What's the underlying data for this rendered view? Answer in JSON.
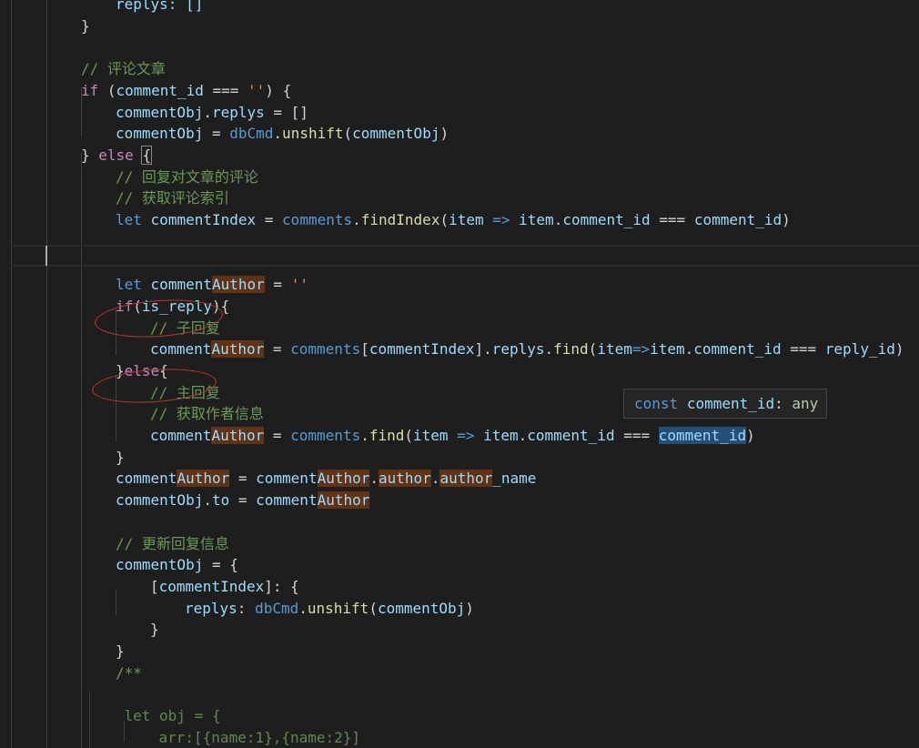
{
  "lines": [
    {
      "indent": 2,
      "tokens": [
        {
          "t": "replys: []",
          "c": "v"
        }
      ]
    },
    {
      "indent": 1,
      "tokens": [
        {
          "t": "}",
          "c": "d"
        }
      ]
    },
    {
      "indent": 0,
      "tokens": []
    },
    {
      "indent": 1,
      "tokens": [
        {
          "t": "// 评论文章",
          "c": "m"
        }
      ]
    },
    {
      "indent": 1,
      "tokens": [
        {
          "t": "if",
          "c": "c"
        },
        {
          "t": " (",
          "c": "d"
        },
        {
          "t": "comment_id",
          "c": "v"
        },
        {
          "t": " === ",
          "c": "o"
        },
        {
          "t": "''",
          "c": "s"
        },
        {
          "t": ") {",
          "c": "d"
        }
      ]
    },
    {
      "indent": 2,
      "tokens": [
        {
          "t": "commentObj",
          "c": "v"
        },
        {
          "t": ".",
          "c": "d"
        },
        {
          "t": "replys",
          "c": "v"
        },
        {
          "t": " = []",
          "c": "d"
        }
      ]
    },
    {
      "indent": 2,
      "tokens": [
        {
          "t": "commentObj",
          "c": "v"
        },
        {
          "t": " = ",
          "c": "d"
        },
        {
          "t": "dbCmd",
          "c": "k"
        },
        {
          "t": ".",
          "c": "d"
        },
        {
          "t": "unshift",
          "c": "f"
        },
        {
          "t": "(",
          "c": "d"
        },
        {
          "t": "commentObj",
          "c": "v"
        },
        {
          "t": ")",
          "c": "d"
        }
      ]
    },
    {
      "indent": 1,
      "tokens": [
        {
          "t": "} ",
          "c": "d"
        },
        {
          "t": "else",
          "c": "c"
        },
        {
          "t": " ",
          "c": "d"
        },
        {
          "t": "{",
          "c": "d",
          "bracket": true
        }
      ]
    },
    {
      "indent": 2,
      "tokens": [
        {
          "t": "// 回复对文章的评论",
          "c": "m"
        }
      ]
    },
    {
      "indent": 2,
      "tokens": [
        {
          "t": "// 获取评论索引",
          "c": "m"
        }
      ]
    },
    {
      "indent": 2,
      "tokens": [
        {
          "t": "let",
          "c": "k"
        },
        {
          "t": " ",
          "c": "d"
        },
        {
          "t": "commentIndex",
          "c": "v"
        },
        {
          "t": " = ",
          "c": "d"
        },
        {
          "t": "comments",
          "c": "k"
        },
        {
          "t": ".",
          "c": "d"
        },
        {
          "t": "findIndex",
          "c": "f"
        },
        {
          "t": "(",
          "c": "d"
        },
        {
          "t": "item",
          "c": "v"
        },
        {
          "t": " => ",
          "c": "k"
        },
        {
          "t": "item",
          "c": "v"
        },
        {
          "t": ".",
          "c": "d"
        },
        {
          "t": "comment_id",
          "c": "v"
        },
        {
          "t": " === ",
          "c": "o"
        },
        {
          "t": "comment_id",
          "c": "v"
        },
        {
          "t": ")",
          "c": "d"
        }
      ]
    },
    {
      "indent": 0,
      "tokens": []
    },
    {
      "indent": 0,
      "tokens": []
    },
    {
      "indent": 2,
      "tokens": [
        {
          "t": "let",
          "c": "k"
        },
        {
          "t": " ",
          "c": "d"
        },
        {
          "t": "comment",
          "c": "v"
        },
        {
          "t": "Author",
          "c": "v",
          "hl": true
        },
        {
          "t": " = ",
          "c": "d"
        },
        {
          "t": "''",
          "c": "s"
        }
      ]
    },
    {
      "indent": 2,
      "tokens": [
        {
          "t": "if",
          "c": "c"
        },
        {
          "t": "(",
          "c": "d"
        },
        {
          "t": "is_reply",
          "c": "v"
        },
        {
          "t": "){",
          "c": "d"
        }
      ]
    },
    {
      "indent": 3,
      "tokens": [
        {
          "t": "// 子回复",
          "c": "m"
        }
      ]
    },
    {
      "indent": 3,
      "tokens": [
        {
          "t": "comment",
          "c": "v"
        },
        {
          "t": "Author",
          "c": "v",
          "hl": true
        },
        {
          "t": " = ",
          "c": "d"
        },
        {
          "t": "comments",
          "c": "k"
        },
        {
          "t": "[",
          "c": "d"
        },
        {
          "t": "commentIndex",
          "c": "v"
        },
        {
          "t": "].",
          "c": "d"
        },
        {
          "t": "replys",
          "c": "v"
        },
        {
          "t": ".",
          "c": "d"
        },
        {
          "t": "find",
          "c": "f"
        },
        {
          "t": "(",
          "c": "d"
        },
        {
          "t": "item",
          "c": "v"
        },
        {
          "t": "=>",
          "c": "k"
        },
        {
          "t": "item",
          "c": "v"
        },
        {
          "t": ".",
          "c": "d"
        },
        {
          "t": "comment_id",
          "c": "v"
        },
        {
          "t": " === ",
          "c": "o"
        },
        {
          "t": "reply_id",
          "c": "v"
        },
        {
          "t": ")",
          "c": "d"
        }
      ]
    },
    {
      "indent": 2,
      "tokens": [
        {
          "t": "}",
          "c": "d"
        },
        {
          "t": "else",
          "c": "c"
        },
        {
          "t": "{",
          "c": "d"
        }
      ]
    },
    {
      "indent": 3,
      "tokens": [
        {
          "t": "// 主回复",
          "c": "m"
        }
      ]
    },
    {
      "indent": 3,
      "tokens": [
        {
          "t": "// 获取作者信息",
          "c": "m"
        }
      ]
    },
    {
      "indent": 3,
      "tokens": [
        {
          "t": "comment",
          "c": "v"
        },
        {
          "t": "Author",
          "c": "v",
          "hl": true
        },
        {
          "t": " = ",
          "c": "d"
        },
        {
          "t": "comments",
          "c": "k"
        },
        {
          "t": ".",
          "c": "d"
        },
        {
          "t": "find",
          "c": "f"
        },
        {
          "t": "(",
          "c": "d"
        },
        {
          "t": "item",
          "c": "v"
        },
        {
          "t": " => ",
          "c": "k"
        },
        {
          "t": "item",
          "c": "v"
        },
        {
          "t": ".",
          "c": "d"
        },
        {
          "t": "comment_id",
          "c": "v"
        },
        {
          "t": " === ",
          "c": "o"
        },
        {
          "t": "comment_id",
          "c": "v",
          "hlb": true
        },
        {
          "t": ")",
          "c": "d"
        }
      ]
    },
    {
      "indent": 2,
      "tokens": [
        {
          "t": "}",
          "c": "d"
        }
      ]
    },
    {
      "indent": 2,
      "tokens": [
        {
          "t": "comment",
          "c": "v"
        },
        {
          "t": "Author",
          "c": "v",
          "hl": true
        },
        {
          "t": " = ",
          "c": "d"
        },
        {
          "t": "comment",
          "c": "v"
        },
        {
          "t": "Author",
          "c": "v",
          "hl": true
        },
        {
          "t": ".",
          "c": "d"
        },
        {
          "t": "author",
          "c": "v",
          "hl": true
        },
        {
          "t": ".",
          "c": "d"
        },
        {
          "t": "author",
          "c": "v",
          "hl": true
        },
        {
          "t": "_name",
          "c": "v"
        }
      ]
    },
    {
      "indent": 2,
      "tokens": [
        {
          "t": "commentObj",
          "c": "v"
        },
        {
          "t": ".",
          "c": "d"
        },
        {
          "t": "to",
          "c": "v"
        },
        {
          "t": " = ",
          "c": "d"
        },
        {
          "t": "comment",
          "c": "v"
        },
        {
          "t": "Author",
          "c": "v",
          "hl": true
        }
      ]
    },
    {
      "indent": 0,
      "tokens": []
    },
    {
      "indent": 2,
      "tokens": [
        {
          "t": "// 更新回复信息",
          "c": "m"
        }
      ]
    },
    {
      "indent": 2,
      "tokens": [
        {
          "t": "commentObj",
          "c": "v"
        },
        {
          "t": " = {",
          "c": "d"
        }
      ]
    },
    {
      "indent": 3,
      "tokens": [
        {
          "t": "[",
          "c": "d"
        },
        {
          "t": "commentIndex",
          "c": "v"
        },
        {
          "t": "]: {",
          "c": "d"
        }
      ]
    },
    {
      "indent": 4,
      "tokens": [
        {
          "t": "replys",
          "c": "v"
        },
        {
          "t": ": ",
          "c": "d"
        },
        {
          "t": "dbCmd",
          "c": "k"
        },
        {
          "t": ".",
          "c": "d"
        },
        {
          "t": "unshift",
          "c": "f"
        },
        {
          "t": "(",
          "c": "d"
        },
        {
          "t": "commentObj",
          "c": "v"
        },
        {
          "t": ")",
          "c": "d"
        }
      ]
    },
    {
      "indent": 3,
      "tokens": [
        {
          "t": "}",
          "c": "d"
        }
      ]
    },
    {
      "indent": 2,
      "tokens": [
        {
          "t": "}",
          "c": "d"
        }
      ]
    },
    {
      "indent": 2,
      "tokens": [
        {
          "t": "/**",
          "c": "m"
        }
      ]
    },
    {
      "indent": 0,
      "tokens": []
    },
    {
      "indent": 2.25,
      "tokens": [
        {
          "t": "let obj = {",
          "c": "dm"
        }
      ]
    },
    {
      "indent": 3.25,
      "tokens": [
        {
          "t": "arr:[{name:1},{name:2}]",
          "c": "dm"
        }
      ]
    },
    {
      "indent": 2.25,
      "tokens": [
        {
          "t": "}",
          "c": "dm"
        }
      ]
    }
  ],
  "hover": {
    "keyword": "const",
    "name": "comment_id",
    "sep": ": ",
    "type": "any"
  },
  "colors": {
    "background": "#1e1e1e",
    "keyword": "#569cd6",
    "control": "#c586c0",
    "variable": "#9cdcfe",
    "function": "#dcdcaa",
    "string": "#ce9178",
    "comment": "#6a9955",
    "occurrence_highlight": "#613214",
    "selection_highlight": "#264f78",
    "annotation_ellipse": "#c0392b"
  }
}
